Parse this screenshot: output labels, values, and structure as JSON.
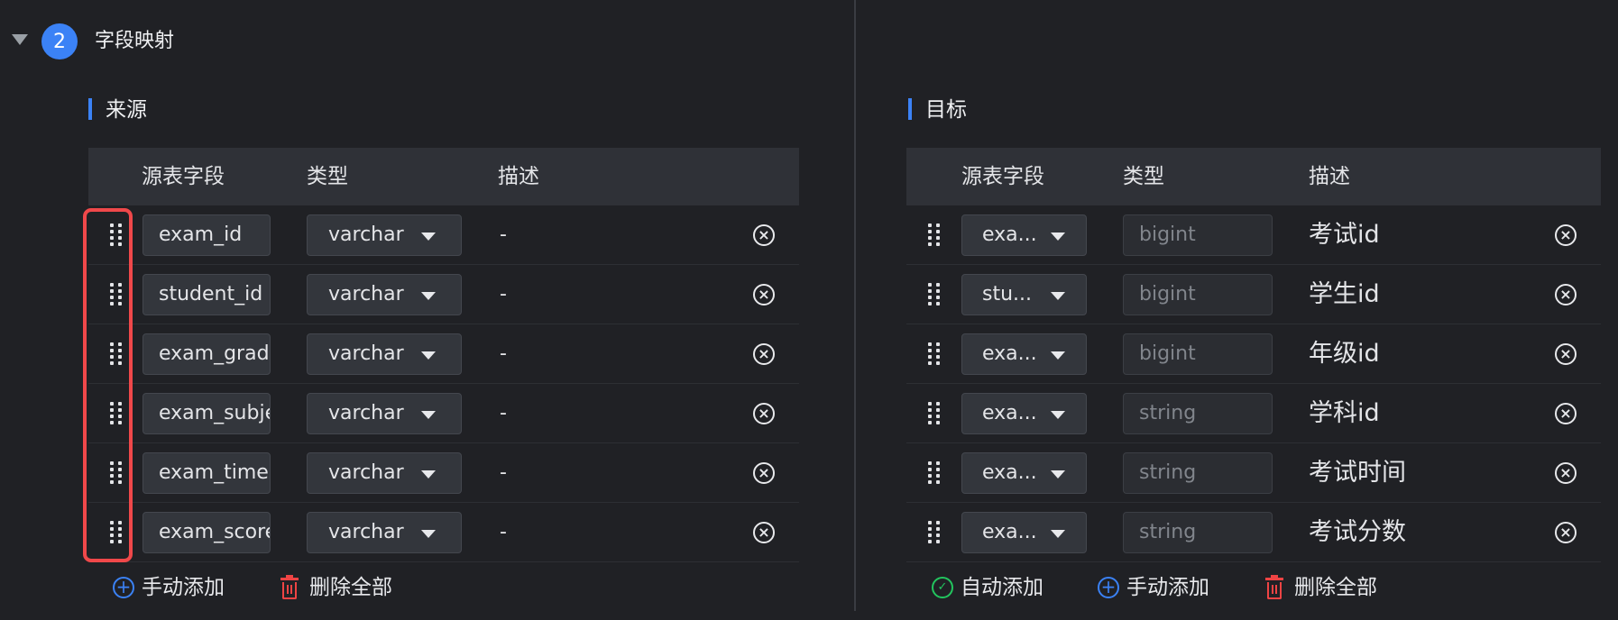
{
  "section": {
    "step": "2",
    "title": "字段映射"
  },
  "source": {
    "title": "来源",
    "headers": {
      "field": "源表字段",
      "type": "类型",
      "desc": "描述"
    },
    "rows": [
      {
        "field": "exam_id",
        "type": "varchar",
        "desc": "-"
      },
      {
        "field": "student_id",
        "type": "varchar",
        "desc": "-"
      },
      {
        "field": "exam_grade_id",
        "type": "varchar",
        "desc": "-"
      },
      {
        "field": "exam_subject_id",
        "type": "varchar",
        "desc": "-"
      },
      {
        "field": "exam_time",
        "type": "varchar",
        "desc": "-"
      },
      {
        "field": "exam_score",
        "type": "varchar",
        "desc": "-"
      }
    ],
    "actions": {
      "manual_add": "手动添加",
      "delete_all": "删除全部"
    }
  },
  "target": {
    "title": "目标",
    "headers": {
      "field": "源表字段",
      "type": "类型",
      "desc": "描述"
    },
    "rows": [
      {
        "field": "exa...",
        "type": "bigint",
        "desc": "考试id"
      },
      {
        "field": "stu...",
        "type": "bigint",
        "desc": "学生id"
      },
      {
        "field": "exa...",
        "type": "bigint",
        "desc": "年级id"
      },
      {
        "field": "exa...",
        "type": "string",
        "desc": "学科id"
      },
      {
        "field": "exa...",
        "type": "string",
        "desc": "考试时间"
      },
      {
        "field": "exa...",
        "type": "string",
        "desc": "考试分数"
      }
    ],
    "actions": {
      "auto_add": "自动添加",
      "manual_add": "手动添加",
      "delete_all": "删除全部"
    }
  },
  "icons": {
    "collapse": "triangle-down-icon",
    "drag": "drag-handle-icon",
    "remove": "close-circle-icon",
    "add": "plus-circle-icon",
    "auto": "auto-add-icon",
    "delete": "trash-icon"
  },
  "colors": {
    "accent": "#3b82f6",
    "danger": "#ef4444",
    "success": "#22c55e",
    "highlight": "#f0484a"
  }
}
